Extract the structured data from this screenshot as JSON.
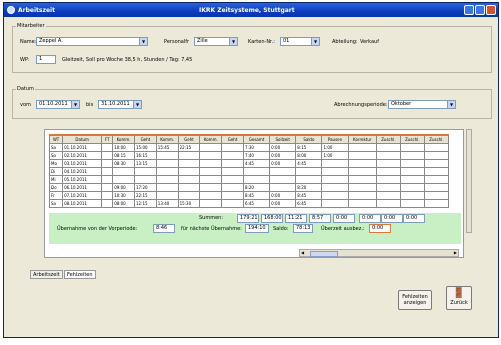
{
  "window": {
    "title_left": "Arbeitszeit",
    "title_center": "IKRK Zeitsysteme, Stuttgart"
  },
  "mitarbeiter": {
    "group_label": "Mitarbeiter",
    "name_label": "Name:",
    "name_value": "Zeppel A.",
    "personal_label": "Personalfr",
    "personal_value": "Zille",
    "kartennr_label": "Karten-Nr.:",
    "kartennr_value": "01",
    "abteilung_label": "Abteilung:",
    "abteilung_value": "Verkauf",
    "wp_label": "WP:",
    "wp_value": "1",
    "wp_info": "Gleitzeit, Soll pro Woche 38,5 h, Stunden / Tag: 7,45"
  },
  "datum": {
    "group_label": "Datum",
    "von_label": "vom",
    "von_value": "01.10.2011",
    "bis_label": "bis",
    "bis_value": "31.10.2011",
    "abrechnung_label": "Abrechnungsperiode:",
    "abrechnung_value": "Oktober"
  },
  "grid": {
    "headers": [
      "WT",
      "Datum",
      "FT",
      "Komm.",
      "Geht",
      "Komm.",
      "Geht",
      "Komm.",
      "Geht",
      "Gesamt",
      "Sollzeit",
      "Saldo",
      "Pausen",
      "Korrektur",
      "Zuschl.",
      "Zuschl.",
      "Zuschl."
    ],
    "rows": [
      [
        "Sa",
        "01.10.2011",
        "",
        "10:00",
        "15:00",
        "15:45",
        "22:15",
        "",
        "",
        "7:30",
        "0:00",
        "8:15",
        "1:00",
        "",
        "",
        "",
        ""
      ],
      [
        "So",
        "02.10.2011",
        "",
        "08:15",
        "16:15",
        "",
        "",
        "",
        "",
        "7:40",
        "0:00",
        "8:00",
        "1:00",
        "",
        "",
        "",
        ""
      ],
      [
        "Mo",
        "03.10.2011",
        "",
        "08:30",
        "13:15",
        "",
        "",
        "",
        "",
        "4:45",
        "0:00",
        "4:45",
        "",
        "",
        "",
        "",
        ""
      ],
      [
        "Di",
        "04.10.2011",
        "",
        "",
        "",
        "",
        "",
        "",
        "",
        "",
        "",
        "",
        "",
        "",
        "",
        "",
        ""
      ],
      [
        "Mi",
        "05.10.2011",
        "",
        "",
        "",
        "",
        "",
        "",
        "",
        "",
        "",
        "",
        "",
        "",
        "",
        "",
        ""
      ],
      [
        "Do",
        "06.10.2011",
        "",
        "09:00",
        "17:20",
        "",
        "",
        "",
        "",
        "8:20",
        "",
        "8:20",
        "",
        "",
        "",
        "",
        ""
      ],
      [
        "Fr",
        "07.10.2011",
        "",
        "10:30",
        "22:15",
        "",
        "",
        "",
        "",
        "8:45",
        "0:00",
        "8:45",
        "",
        "",
        "",
        "",
        ""
      ],
      [
        "Sa",
        "08.10.2011",
        "",
        "08:00",
        "12:15",
        "13:40",
        "15:30",
        "",
        "",
        "6:45",
        "0:00",
        "6:45",
        "",
        "",
        "",
        "",
        ""
      ]
    ],
    "summen_label": "Summen:",
    "summen_values": [
      "179:21",
      "168:00",
      "11:21",
      "8:57",
      "0:00",
      "0:00",
      "0:00",
      "0:00"
    ],
    "uebernahme_vormonat_label": "Übernahme von der Vorperiode:",
    "uebernahme_vormonat_value": "8:46",
    "uebernahme_label": "für nächste Übernahme:",
    "uebernahme_value": "194:10",
    "saldo_label": "Saldo:",
    "saldo_value": "78:13",
    "ueberzeit_label": "Überzeit ausbez.:",
    "ueberzeit_value": "0:00"
  },
  "tabs": {
    "tab1": "Arbeitszeit",
    "tab2": "Fehlzeiten"
  },
  "buttons": {
    "fehlzeiten_line1": "Fehlzeiten",
    "fehlzeiten_line2": "anzeigen",
    "zurueck": "Zurück"
  }
}
